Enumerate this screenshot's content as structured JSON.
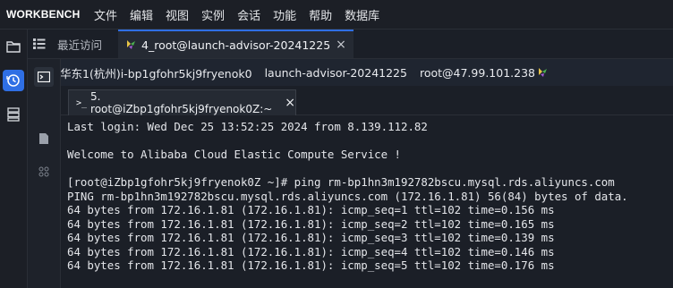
{
  "app": {
    "brand": "WORKBENCH"
  },
  "menu": [
    "文件",
    "编辑",
    "视图",
    "实例",
    "会话",
    "功能",
    "帮助",
    "数据库"
  ],
  "activity_bar": [
    {
      "icon": "folder-icon",
      "active": false
    },
    {
      "icon": "history-icon",
      "active": true
    },
    {
      "icon": "server-list-icon",
      "active": false
    }
  ],
  "tabs": {
    "recent_label": "最近访问",
    "active_label": "4_root@launch-advisor-20241225",
    "close_glyph": "×"
  },
  "connection": {
    "instance": "华东1(杭州)i-bp1gfohr5kj9fryenok0",
    "name": "launch-advisor-20241225",
    "login": "root@47.99.101.238"
  },
  "terminal_tab": {
    "label": "5. root@iZbp1gfohr5kj9fryenok0Z:~",
    "prompt_glyph": ">_",
    "close_glyph": "×"
  },
  "side_icons": [
    "terminal-icon",
    "file-icon",
    "settings-icon"
  ],
  "terminal": {
    "lines": [
      "Last login: Wed Dec 25 13:52:25 2024 from 8.139.112.82",
      "",
      "Welcome to Alibaba Cloud Elastic Compute Service !",
      "",
      "[root@iZbp1gfohr5kj9fryenok0Z ~]# ping rm-bp1hn3m192782bscu.mysql.rds.aliyuncs.com",
      "PING rm-bp1hn3m192782bscu.mysql.rds.aliyuncs.com (172.16.1.81) 56(84) bytes of data.",
      "64 bytes from 172.16.1.81 (172.16.1.81): icmp_seq=1 ttl=102 time=0.156 ms",
      "64 bytes from 172.16.1.81 (172.16.1.81): icmp_seq=2 ttl=102 time=0.165 ms",
      "64 bytes from 172.16.1.81 (172.16.1.81): icmp_seq=3 ttl=102 time=0.139 ms",
      "64 bytes from 172.16.1.81 (172.16.1.81): icmp_seq=4 ttl=102 time=0.146 ms",
      "64 bytes from 172.16.1.81 (172.16.1.81): icmp_seq=5 ttl=102 time=0.176 ms"
    ]
  },
  "colors": {
    "accent": "#2f6fe4",
    "background": "#1b1f27",
    "spark_green": "#4caf50",
    "spark_yellow": "#e8c547",
    "spark_purple": "#a35bd6"
  }
}
